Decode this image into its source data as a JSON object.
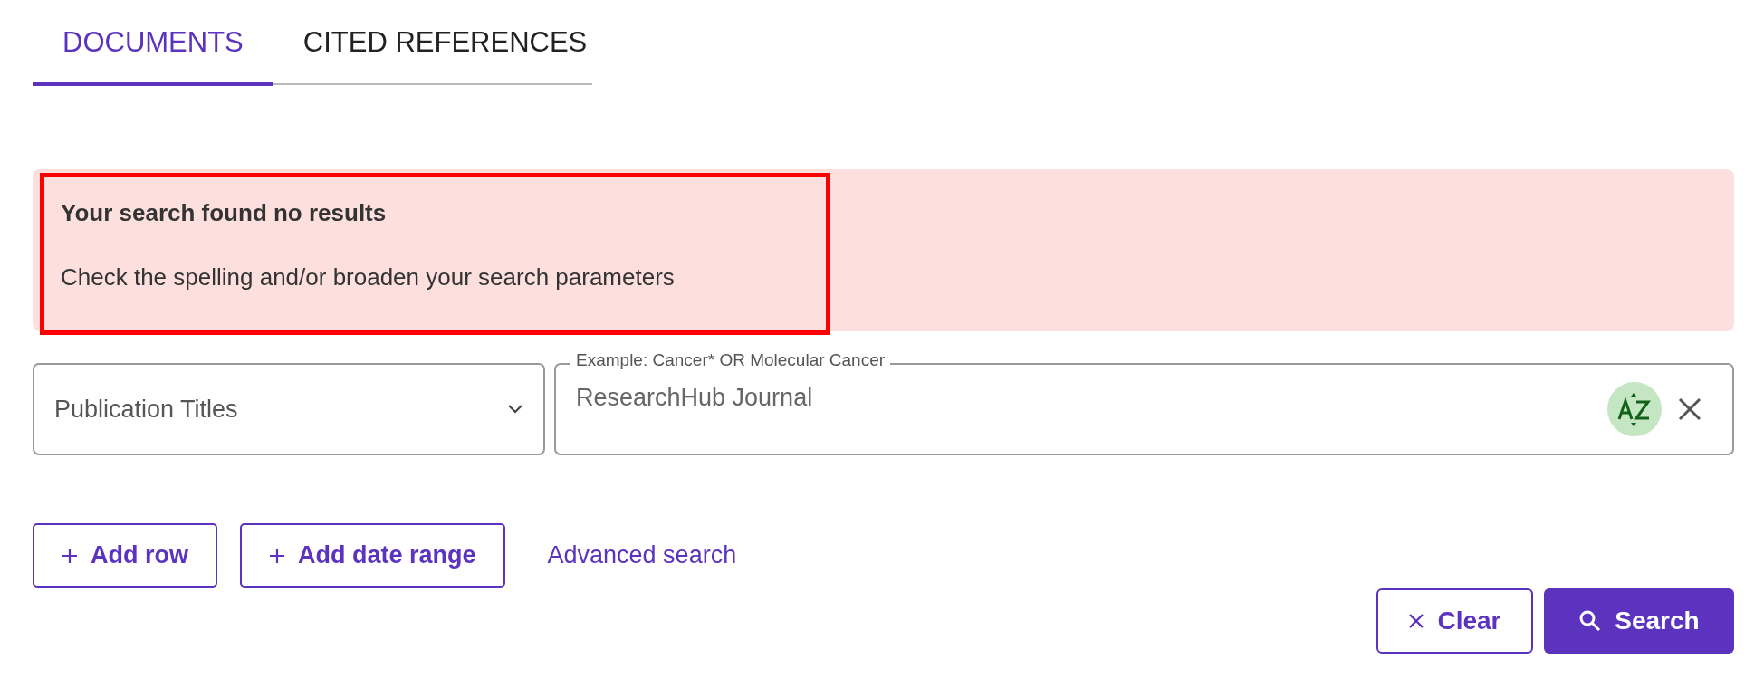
{
  "tabs": [
    {
      "label": "DOCUMENTS",
      "selected": true
    },
    {
      "label": "CITED REFERENCES",
      "selected": false
    }
  ],
  "alert": {
    "title": "Your search found no results",
    "message": "Check the spelling and/or broaden your search parameters",
    "highlighted": true
  },
  "field_select": {
    "value": "Publication Titles"
  },
  "query": {
    "label": "Example: Cancer* OR Molecular Cancer",
    "value": "ResearchHub Journal"
  },
  "actions": [
    {
      "label": "Add row",
      "kind": "outline"
    },
    {
      "label": "Add date range",
      "kind": "outline"
    },
    {
      "label": "Advanced search",
      "kind": "link"
    }
  ],
  "buttons": [
    {
      "label": "Clear",
      "kind": "secondary"
    },
    {
      "label": "Search",
      "kind": "primary"
    }
  ]
}
